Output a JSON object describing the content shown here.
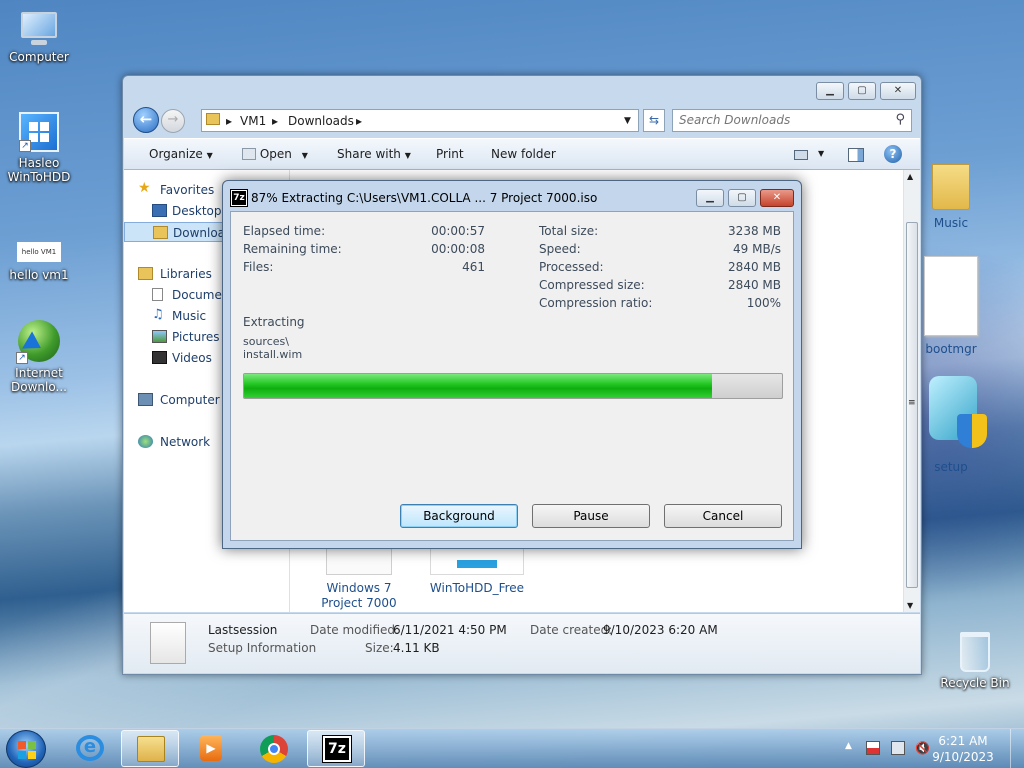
{
  "desktop": {
    "icons": [
      {
        "label": "Computer"
      },
      {
        "label": "Hasleo WinToHDD"
      },
      {
        "label": "hello vm1",
        "thumb_text": "hello VM1"
      },
      {
        "label": "Internet Downlo..."
      },
      {
        "label": "Recycle Bin"
      }
    ]
  },
  "explorer": {
    "caption_buttons": {
      "minimize": "▁",
      "maximize": "▢",
      "close": "✕"
    },
    "address": {
      "segments": [
        "VM1",
        "Downloads"
      ]
    },
    "search": {
      "placeholder": "Search Downloads"
    },
    "toolbar": {
      "organize": "Organize",
      "open": "Open",
      "share_with": "Share with",
      "print": "Print",
      "new_folder": "New folder"
    },
    "nav": {
      "favorites": "Favorites",
      "desktop": "Desktop",
      "downloads": "Downloads",
      "libraries": "Libraries",
      "documents": "Documents",
      "music": "Music",
      "pictures": "Pictures",
      "videos": "Videos",
      "computer": "Computer",
      "network": "Network"
    },
    "files": [
      {
        "label": "Music",
        "type": "folder"
      },
      {
        "label": "bootmgr",
        "type": "file"
      },
      {
        "label": "setup",
        "type": "setup"
      },
      {
        "label": "Windows 7 Project 7000",
        "type": "disc"
      },
      {
        "label": "WinToHDD_Free",
        "type": "installer"
      }
    ],
    "status": {
      "name": "Lastsession",
      "type": "Setup Information",
      "modified_label": "Date modified:",
      "modified": "6/11/2021 4:50 PM",
      "size_label": "Size:",
      "size": "4.11 KB",
      "created_label": "Date created:",
      "created": "9/10/2023 6:20 AM"
    }
  },
  "dialog": {
    "title": "87% Extracting C:\\Users\\VM1.COLLA ... 7 Project 7000.iso",
    "icon_text": "7z",
    "left_stats": [
      {
        "label": "Elapsed time:",
        "value": "00:00:57"
      },
      {
        "label": "Remaining time:",
        "value": "00:00:08"
      },
      {
        "label": "Files:",
        "value": "461"
      }
    ],
    "right_stats": [
      {
        "label": "Total size:",
        "value": "3238 MB"
      },
      {
        "label": "Speed:",
        "value": "49 MB/s"
      },
      {
        "label": "Processed:",
        "value": "2840 MB"
      },
      {
        "label": "Compressed size:",
        "value": "2840 MB"
      },
      {
        "label": "Compression ratio:",
        "value": "100%"
      }
    ],
    "action": "Extracting",
    "path_line1": "sources\\",
    "path_line2": "install.wim",
    "progress_fraction": 0.87,
    "buttons": {
      "background": "Background",
      "pause": "Pause",
      "cancel": "Cancel"
    }
  },
  "taskbar": {
    "apps": [
      "start-button",
      "internet-explorer",
      "windows-explorer",
      "media-player",
      "chrome",
      "7-zip"
    ],
    "seven_zip_text": "7z",
    "clock_time": "6:21 AM",
    "clock_date": "9/10/2023",
    "tray_arrow": "▲"
  },
  "colors": {
    "progress_green": "#1fc01f",
    "explorer_frame": "#c7d9ec",
    "dialog_frame": "#c3d6eb"
  }
}
